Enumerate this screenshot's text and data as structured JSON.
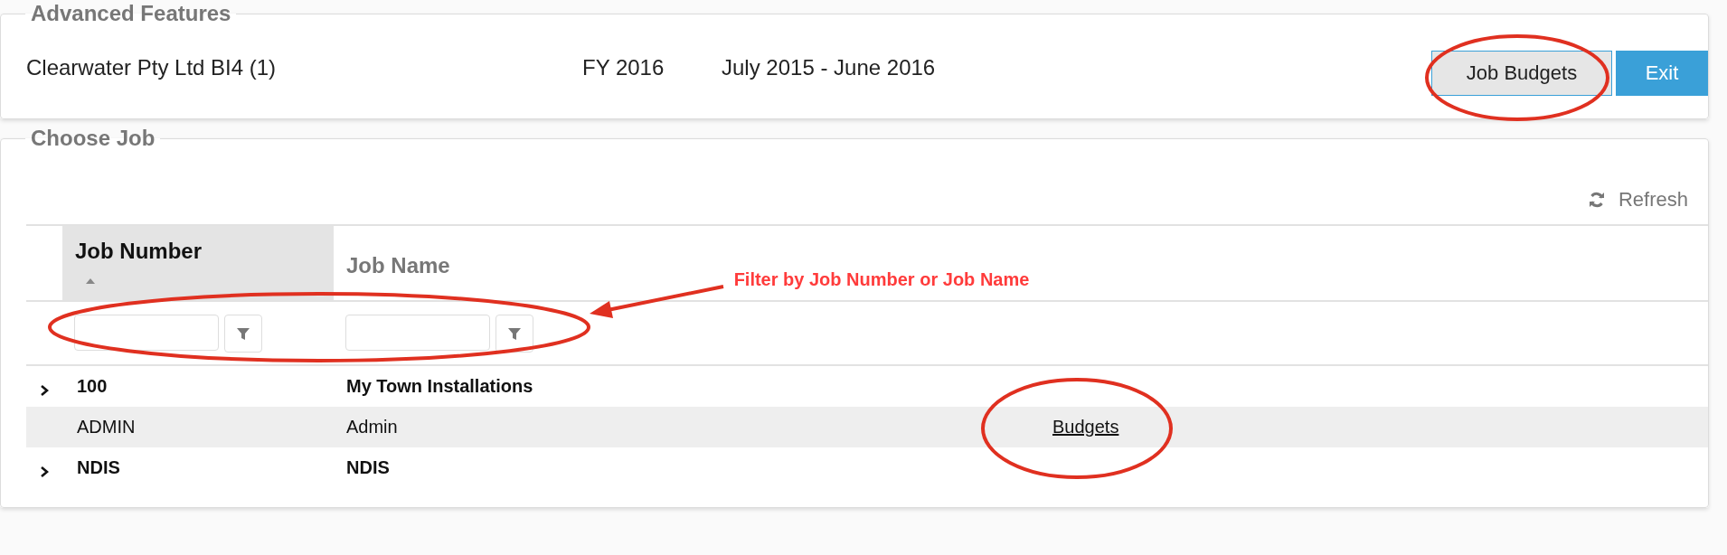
{
  "header_panel": {
    "legend": "Advanced Features",
    "company": "Clearwater Pty Ltd BI4 (1)",
    "fiscal_year": "FY 2016",
    "period": "July 2015 - June 2016",
    "buttons": [
      {
        "label": "Job Budgets",
        "kind": "default"
      },
      {
        "label": "Exit",
        "kind": "primary"
      }
    ]
  },
  "job_panel": {
    "legend": "Choose Job",
    "refresh": "Refresh",
    "columns": [
      {
        "label": "Job Number",
        "sorted": true
      },
      {
        "label": "Job Name",
        "sorted": false
      }
    ],
    "rows": [
      {
        "number": "100",
        "name": "My Town Installations",
        "group": true,
        "expanded": false,
        "highlighted": false
      },
      {
        "number": "ADMIN",
        "name": "Admin",
        "group": false,
        "link": "Budgets",
        "highlighted": true
      },
      {
        "number": "NDIS",
        "name": "NDIS",
        "group": true,
        "expanded": false,
        "highlighted": false
      }
    ]
  },
  "annotation": {
    "text": "Filter by Job Number or Job Name"
  }
}
